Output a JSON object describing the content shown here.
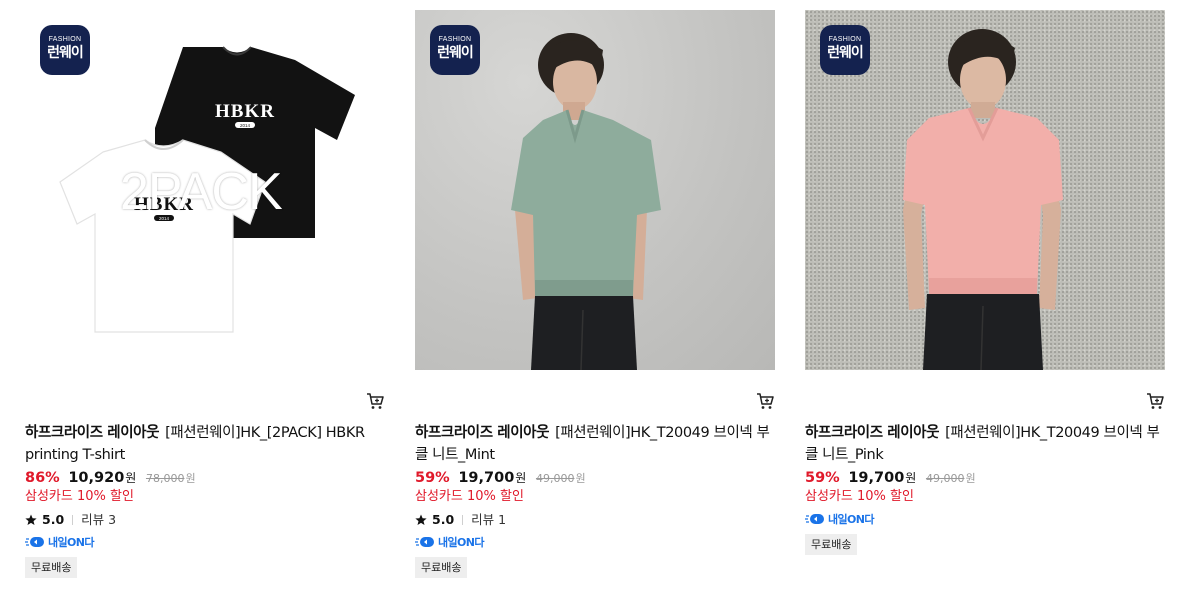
{
  "products": [
    {
      "badge_line1": "FASHION",
      "badge_line2": "런웨이",
      "image_overlay": "2PACK",
      "print_text": "HBKR",
      "print_year": "2014",
      "brand": "하프크라이즈 레이아웃",
      "name": "[패션런웨이]HK_[2PACK] HBKR printing T-shirt",
      "discount": "86%",
      "sale_price": "10,920",
      "sale_unit": "원",
      "original_price": "78,000",
      "original_unit": "원",
      "card_promo": "삼성카드 10% 할인",
      "rating": "5.0",
      "reviews": "리뷰 3",
      "delivery_tag": "내일ON다",
      "shipping": "무료배송",
      "image_colors": {
        "background": "#ffffff",
        "tee_back": "#111111",
        "tee_front": "#ffffff"
      }
    },
    {
      "badge_line1": "FASHION",
      "badge_line2": "런웨이",
      "brand": "하프크라이즈 레이아웃",
      "name": "[패션런웨이]HK_T20049 브이넥 부클 니트_Mint",
      "discount": "59%",
      "sale_price": "19,700",
      "sale_unit": "원",
      "original_price": "49,000",
      "original_unit": "원",
      "card_promo": "삼성카드 10% 할인",
      "rating": "5.0",
      "reviews": "리뷰 1",
      "delivery_tag": "내일ON다",
      "shipping": "무료배송",
      "image_colors": {
        "background": "#c6c6c4",
        "knit": "#8eac9c",
        "pants": "#1e1f22"
      }
    },
    {
      "badge_line1": "FASHION",
      "badge_line2": "런웨이",
      "brand": "하프크라이즈 레이아웃",
      "name": "[패션런웨이]HK_T20049 브이넥 부클 니트_Pink",
      "discount": "59%",
      "sale_price": "19,700",
      "sale_unit": "원",
      "original_price": "49,000",
      "original_unit": "원",
      "card_promo": "삼성카드 10% 할인",
      "delivery_tag": "내일ON다",
      "shipping": "무료배송",
      "image_colors": {
        "background": "#bdbdb7",
        "knit": "#f2afaa",
        "pants": "#1e1f22"
      }
    }
  ],
  "icons": {
    "cart": "cart-icon",
    "star": "star-icon",
    "delivery": "delivery-truck-icon"
  },
  "colors": {
    "discount": "#e0192a",
    "promo": "#e0192a",
    "delivery": "#1a73e8",
    "badge": "#14224f"
  }
}
